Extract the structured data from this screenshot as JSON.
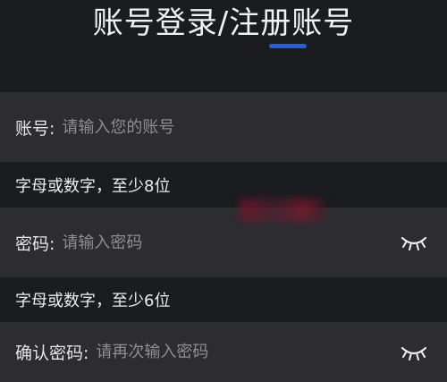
{
  "header": {
    "title": "账号登录/注册账号",
    "underline_color": "#1f5fe6"
  },
  "form": {
    "account": {
      "label": "账号:",
      "placeholder": "请输入您的账号",
      "value": ""
    },
    "account_hint": "字母或数字，至少8位",
    "password": {
      "label": "密码:",
      "placeholder": "请输入密码",
      "value": "",
      "toggle_icon": "eye-closed-icon"
    },
    "password_hint": "字母或数字，至少6位",
    "confirm_password": {
      "label": "确认密码:",
      "placeholder": "请再次输入密码",
      "value": "",
      "toggle_icon": "eye-closed-icon"
    }
  },
  "colors": {
    "background": "#1b1c20",
    "field_background": "#2d2d30",
    "text": "#e6e6e6",
    "placeholder": "#8e8e93"
  }
}
